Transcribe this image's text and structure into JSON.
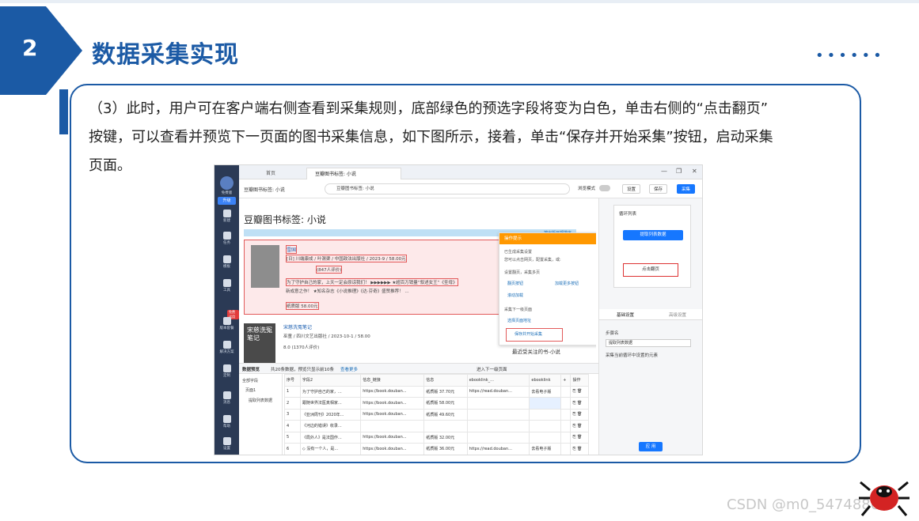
{
  "slide": {
    "section_number": "2",
    "section_title": "数据采集实现",
    "dots": "••••••",
    "paragraph_lines": [
      "（3）此时，用户可在客户端右侧查看到采集规则，底部绿色的预选字段将变为白色，单击右侧的“点击翻页”",
      "按键，可以查看并预览下一页面的图书采集信息，如下图所示，接着，单击“保存并开始采集”按钮，启动采集",
      "页面。"
    ],
    "watermark": "CSDN @m0_54748866",
    "colors": {
      "brand": "#1b5aa5",
      "accent_orange": "#ff9800",
      "highlight_red": "#e25a5a",
      "primary_blue": "#1677ff"
    }
  },
  "app": {
    "sidebar": {
      "user_label": "免费版",
      "upgrade_label": "升级",
      "items": [
        {
          "icon": "plus-icon",
          "label": "新建"
        },
        {
          "icon": "flag-icon",
          "label": "任务"
        },
        {
          "icon": "template-icon",
          "label": "模板"
        },
        {
          "icon": "toolbox-icon",
          "label": "工具"
        },
        {
          "icon": "crown-icon",
          "label": "版本套餐"
        },
        {
          "icon": "solution-icon",
          "label": "解决方案"
        },
        {
          "icon": "custom-icon",
          "label": "定制"
        },
        {
          "icon": "bell-icon",
          "label": "消息"
        },
        {
          "icon": "help-icon",
          "label": "帮助"
        },
        {
          "icon": "settings-icon",
          "label": "设置"
        }
      ],
      "promo_badge": "免费试用"
    },
    "tabs": {
      "home": "首页",
      "active": "豆瓣图书标签: 小说"
    },
    "window_controls": {
      "min": "—",
      "restore": "❐",
      "close": "✕"
    },
    "toolbar": {
      "breadcrumb": "豆瓣图书标签: 小说",
      "url": "豆瓣图书标签: 小说",
      "browse_mode": "浏览模式",
      "settings": "设置",
      "save": "保存",
      "collect": "采集"
    },
    "page": {
      "title": "豆瓣图书标签: 小说",
      "sort_link": "按出版日期排序",
      "book1": {
        "title": "雪国",
        "meta": "[日] 川端康成 / 叶渭渠 / 中国政法出版社 / 2023-9 / 58.00元",
        "rating": "(847人评价)",
        "desc_line1": "为了守护自己的家，上天一定会原谅我们！ ▶▶▶▶▶▶ ★超百万销量“叙述女王”《圣母》",
        "desc_line2": "新成意之作！ ★知名杂志《小说推理》《达·芬奇》盛赞推荐！ ...",
        "buy": "纸质版 58.00元"
      },
      "book2": {
        "cover_text": "宋慈洗冤笔记",
        "title": "宋慈洗冤笔记",
        "meta": "巫童 / 四川文艺出版社 / 2023-10-1 / 58.00",
        "rating": "8.0 (1370人评价)"
      },
      "side_text": "文学",
      "side_btn": "进入",
      "recent": "最近受关注的书-小说"
    },
    "tip": {
      "header": "操作提示",
      "line1": "已生成采集设置",
      "line2": "您可以点击网页，配置采集，或:",
      "group1": "设置翻页，采集多页",
      "opt_click_page": "翻页按钮",
      "opt_load_more": "加载更多按钮",
      "opt_scroll": "滚动加载",
      "group2": "采集下一级页面",
      "opt_select_link": "选择页面地址",
      "opt_save_start": "保存并开始采集"
    },
    "right_panel": {
      "loop_label": "循环列表",
      "extract_btn": "提取列表数据",
      "click_page": "点击翻页",
      "tab_basic": "基础设置",
      "tab_advanced": "高级设置",
      "step_name_label": "步骤名",
      "step_name_value": "提取列表数据",
      "checkbox_label": "采集当前循环中设置的元素",
      "apply": "应 用"
    },
    "preview": {
      "title": "数据预览",
      "summary": "共20条数据，预览只显示前10条",
      "view_more": "查看更多",
      "enter_next": "进入下一级页面",
      "tree": [
        "全部字段",
        "页面1",
        "提取列表数据"
      ],
      "columns": [
        "序号",
        "字段2",
        "信息_链接",
        "信息",
        "ebooklink_...",
        "ebooklink",
        "+",
        "操作"
      ],
      "rows": [
        [
          "1",
          "为了守护自己的家，...",
          "https://book.douban...",
          "纸质版 37.70元",
          "https://read.douban...",
          "去看电子版"
        ],
        [
          "2",
          "跟随世界法医真相家...",
          "https://book.douban...",
          "纸质版 58.00元",
          "",
          ""
        ],
        [
          "3",
          "《亚洲周刊》2020年...",
          "https://book.douban...",
          "纸质版 49.60元",
          "",
          ""
        ],
        [
          "4",
          "《河边的错误》收录...",
          "",
          "",
          "",
          ""
        ],
        [
          "5",
          "《局外人》是法国作...",
          "https://book.douban...",
          "纸质版 32.00元",
          "",
          ""
        ],
        [
          "6",
          "◇ 没有一个人，是...",
          "https://book.douban...",
          "纸质版 36.00元",
          "https://read.douban...",
          "去看电子版"
        ]
      ]
    }
  }
}
